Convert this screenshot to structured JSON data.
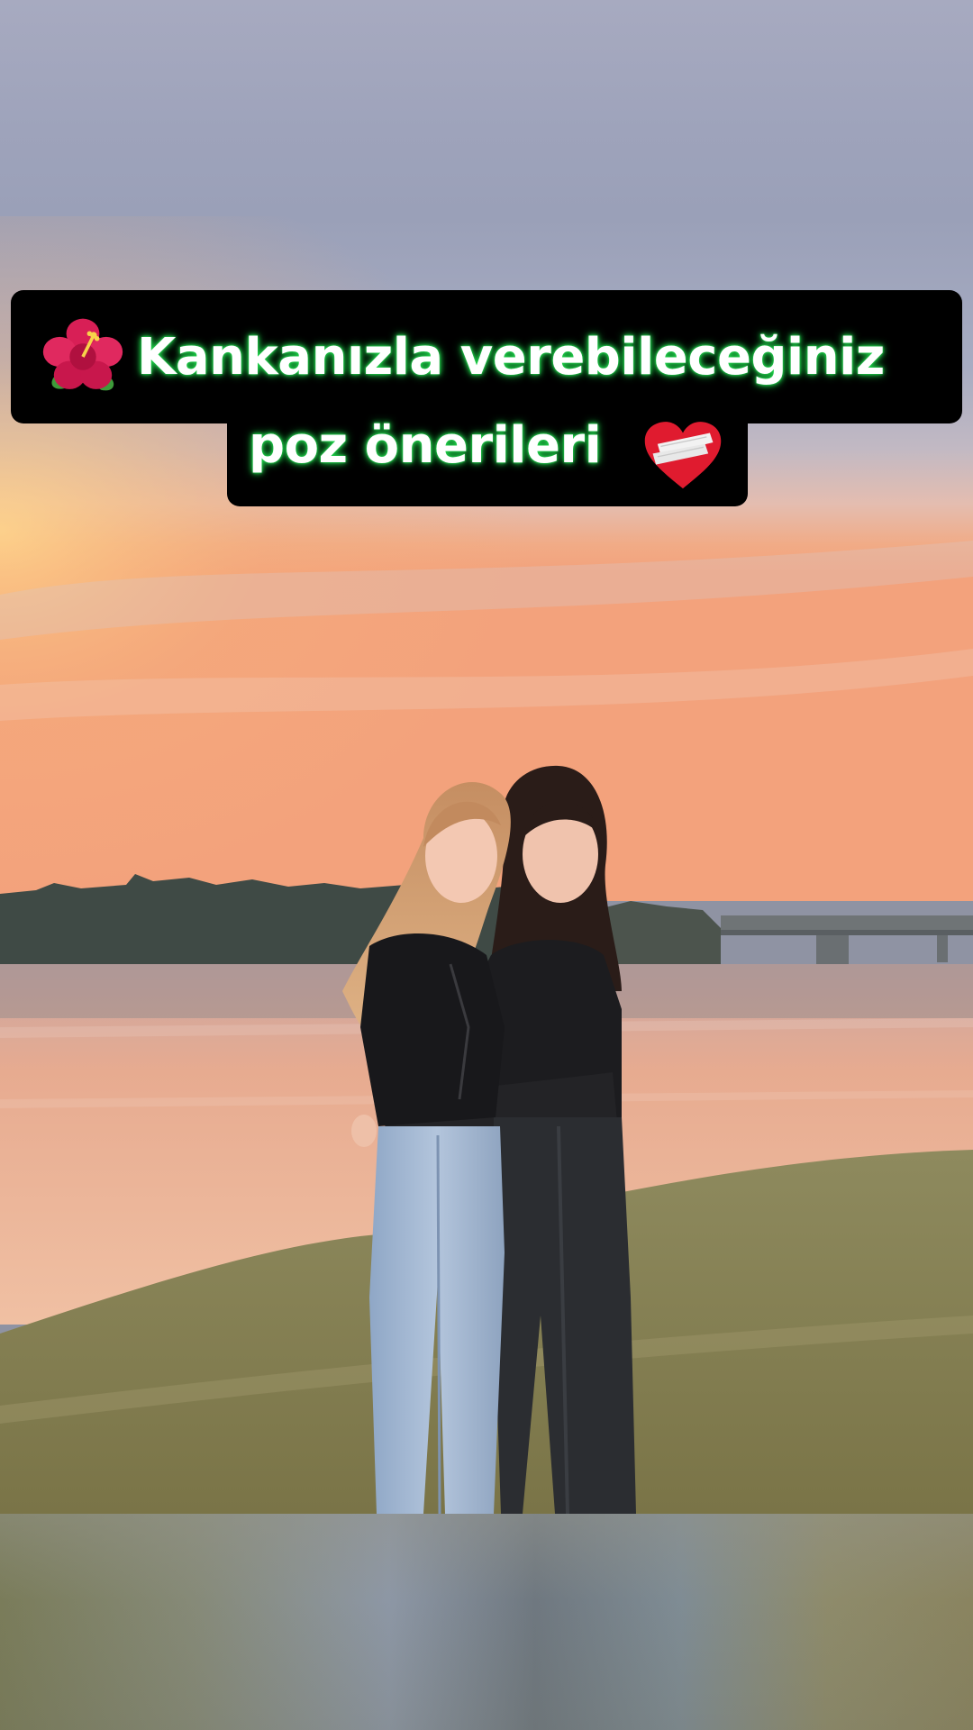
{
  "caption": {
    "line1": "Kankanızla verebileceğiniz",
    "line2": "poz önerileri",
    "leading_icon": "hibiscus-icon",
    "trailing_icon": "mending-heart-icon",
    "text_color": "#ffffff",
    "glow_color": "#1fd14a",
    "box_color": "#000000"
  },
  "photo": {
    "sky_top_color": "#9aa0b8",
    "sunset_color": "#f2a07a",
    "water_color": "#e9a98f",
    "grass_color": "#8a8356"
  }
}
